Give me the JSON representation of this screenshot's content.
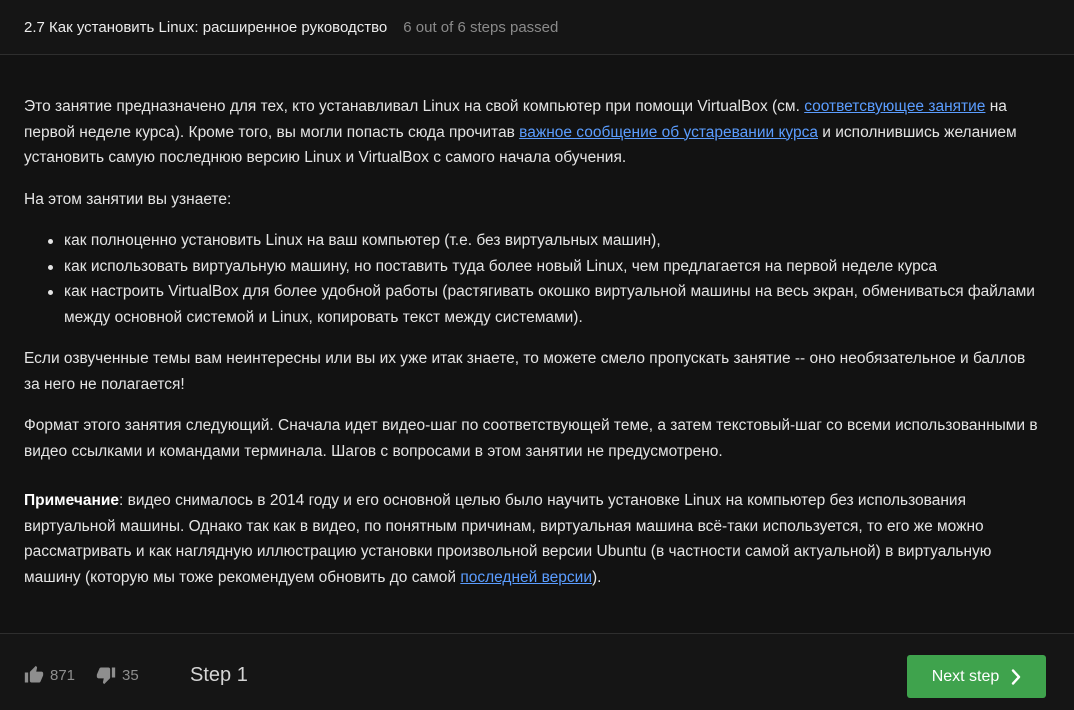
{
  "header": {
    "title": "2.7 Как установить Linux: расширенное руководство",
    "progress": "6 out of 6 steps passed"
  },
  "content": {
    "p1": {
      "t1": "Это занятие предназначено для тех, кто устанавливал Linux на свой компьютер при помощи VirtualBox (см. ",
      "link1": "соответсвующее занятие",
      "t2": " на первой неделе курса). Кроме того, вы могли попасть сюда прочитав ",
      "link2": "важное сообщение об устаревании курса",
      "t3": " и  исполнившись желанием установить самую последнюю версию Linux и VirtualBox с самого начала обучения."
    },
    "p2": "На этом занятии вы узнаете:",
    "list": [
      "как полноценно установить Linux на ваш компьютер (т.е. без виртуальных машин),",
      "как использовать виртуальную машину, но поставить туда более новый Linux, чем предлагается на первой неделе курса",
      "как настроить VirtualBox для более удобной работы (растягивать окошко виртуальной машины на весь экран, обмениваться файлами между основной системой и Linux, копировать текст между системами)."
    ],
    "p3": "Если озвученные темы вам неинтересны или вы их уже итак знаете, то можете смело пропускать занятие -- оно необязательное и баллов за него не полагается!",
    "p4": "Формат этого занятия следующий. Сначала идет видео-шаг по соответствующей теме, а затем текстовый-шаг со всеми использованными в видео ссылками и командами терминала. Шагов с вопросами в этом занятии не предусмотрено.",
    "note": {
      "label": "Примечание",
      "t1": ": видео снималось в 2014 году и его основной целью было научить установке Linux на компьютер без использования виртуальной машины. Однако так как в видео, по понятным причинам, виртуальная машина всё-таки используется, то его же можно рассматривать и как наглядную иллюстрацию установки произвольной версии Ubuntu (в частности самой актуальной) в виртуальную машину (которую мы тоже рекомендуем обновить до самой ",
      "link": "последней версии",
      "t2": ")."
    }
  },
  "footer": {
    "likes": "871",
    "dislikes": "35",
    "step_label": "Step 1",
    "next_label": "Next step",
    "icons": {
      "like": "thumbs-up-icon",
      "dislike": "thumbs-down-icon",
      "next": "chevron-right-icon"
    },
    "colors": {
      "next_button": "#3fa34d",
      "link": "#5b9dff"
    }
  }
}
